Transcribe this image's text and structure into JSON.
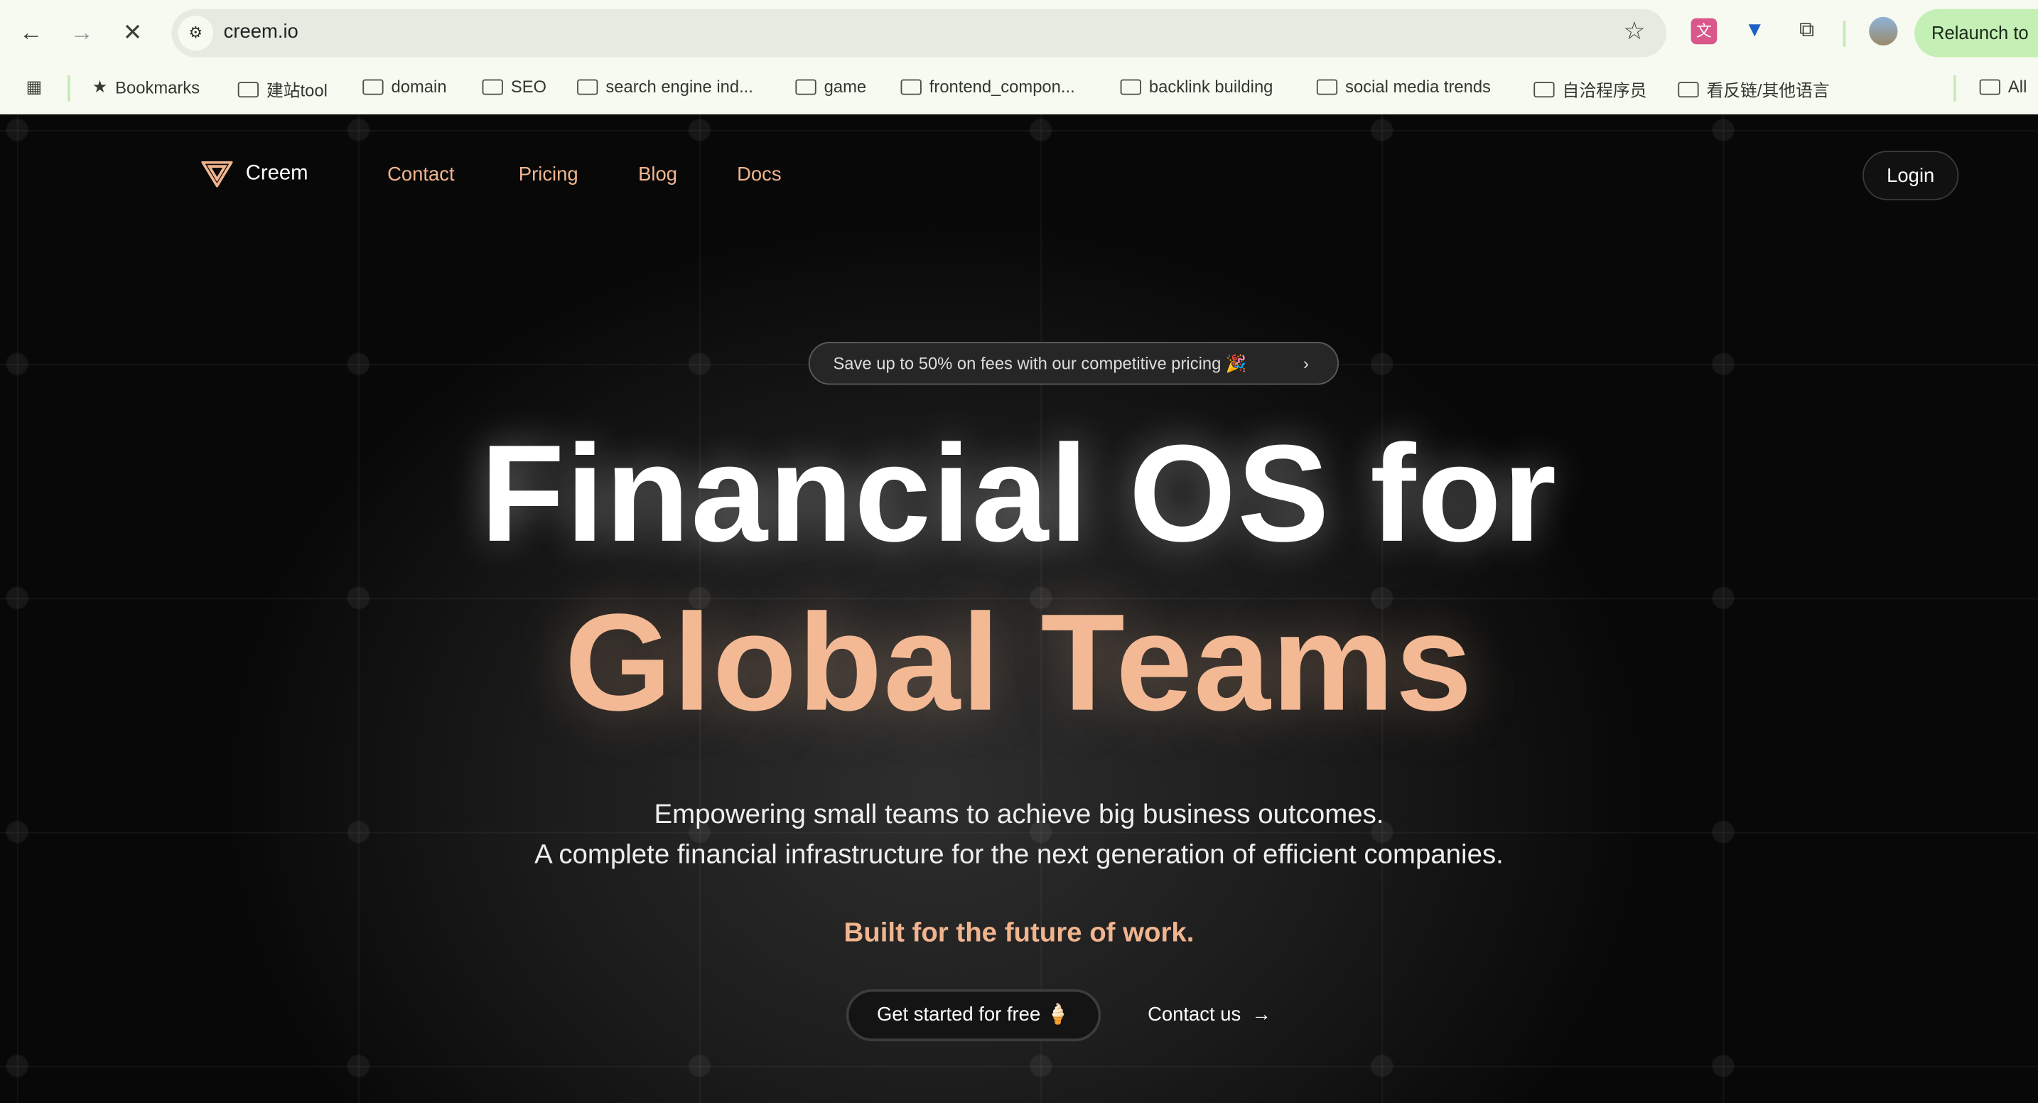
{
  "browser": {
    "url": "creem.io",
    "relaunch_label": "Relaunch to",
    "bookmarks": [
      "Bookmarks",
      "建站tool",
      "domain",
      "SEO",
      "search engine ind...",
      "game",
      "frontend_compon...",
      "backlink building",
      "social media trends",
      "自洽程序员",
      "看反链/其他语言"
    ],
    "all_bookmarks": "All"
  },
  "site": {
    "brand": "Creem",
    "nav": [
      "Contact",
      "Pricing",
      "Blog",
      "Docs"
    ],
    "login": "Login",
    "promo": "Save up to 50% on fees with our competitive pricing 🎉",
    "headline_1": "Financial OS for",
    "headline_2": "Global Teams",
    "subtitle_1": "Empowering small teams to achieve big business outcomes.",
    "subtitle_2": "A complete financial infrastructure for the next generation of efficient companies.",
    "tagline": "Built for the future of work.",
    "cta_primary": "Get started for free 🍦",
    "cta_secondary": "Contact us",
    "accent": "#f3b994"
  }
}
